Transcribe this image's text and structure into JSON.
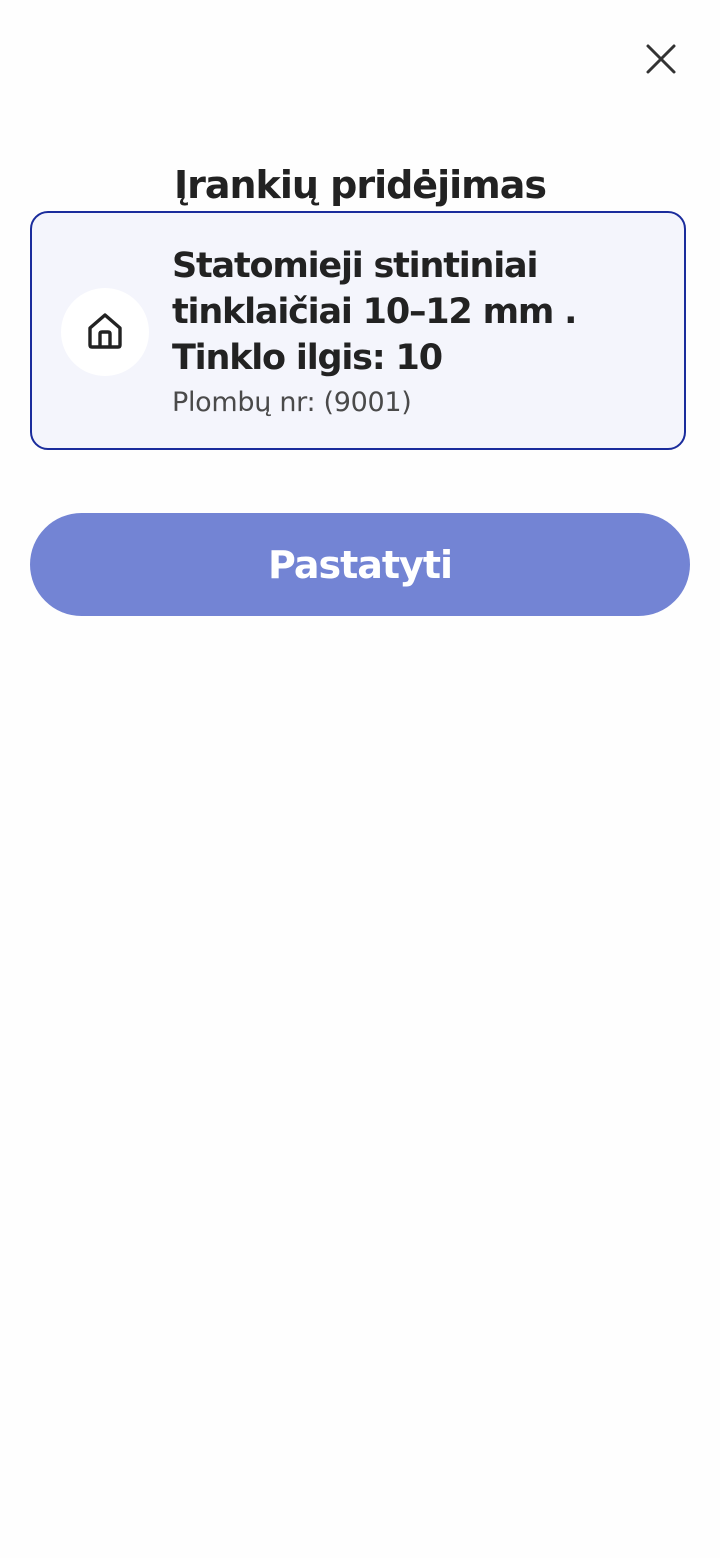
{
  "header": {
    "close_icon": "close-icon",
    "title": "Įrankių pridėjimas"
  },
  "tool_card": {
    "icon": "home-icon",
    "title": "Statomieji stintiniai tinklaičiai 10–12 mm . Tinklo ilgis: 10",
    "subtitle": "Plombų nr: (9001)"
  },
  "actions": {
    "primary_label": "Pastatyti"
  },
  "colors": {
    "card_border": "#1a2c9c",
    "card_background": "#f4f5fc",
    "button_background": "#7384d4",
    "text_primary": "#222222",
    "text_secondary": "#4a4a4a"
  }
}
